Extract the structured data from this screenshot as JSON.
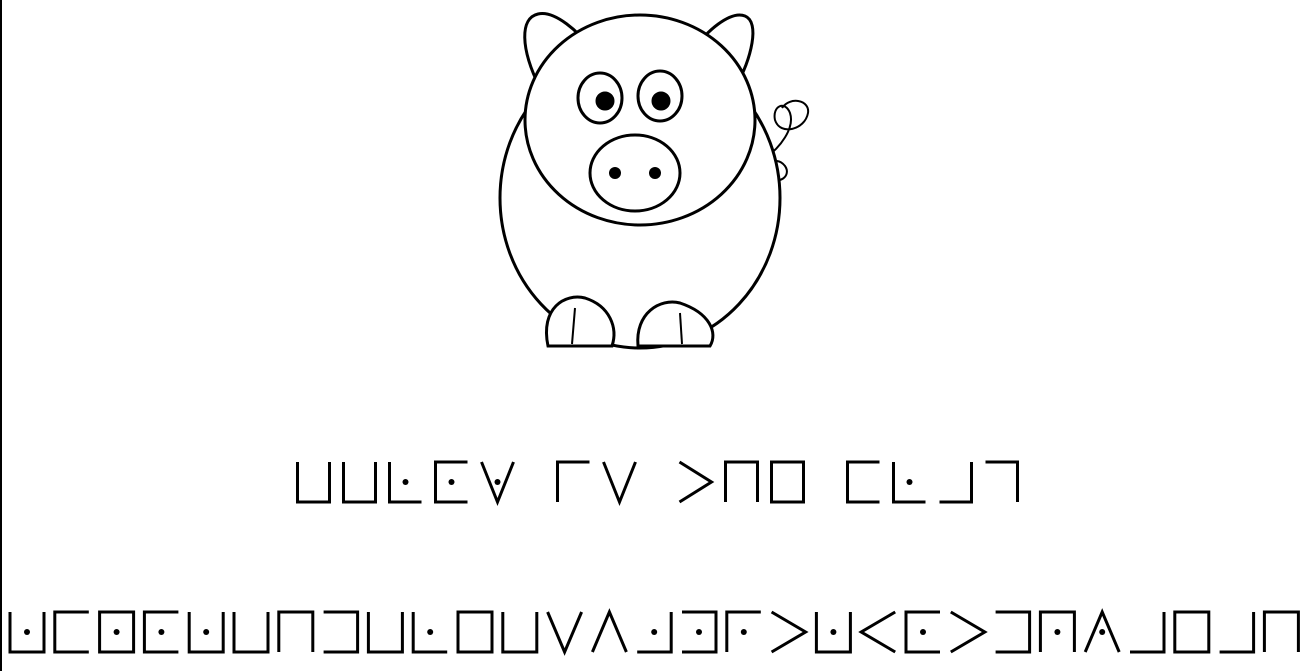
{
  "image": {
    "subject": "pig-illustration"
  },
  "cipher": {
    "line1_words": [
      [
        "U",
        "LT",
        "L.",
        "E.",
        "V."
      ],
      [
        "G",
        "V"
      ],
      [
        ">",
        "N",
        "O"
      ],
      [
        "C",
        "L.",
        "J",
        "7"
      ]
    ],
    "line2_glyphs": [
      "U.",
      "C",
      "O.",
      "E.",
      "U.",
      "U",
      "N",
      "]",
      "U",
      "L.",
      "O",
      "U",
      "V",
      "A",
      ".J",
      "].",
      "G.",
      ">",
      "U.",
      "<",
      "E.",
      ">",
      "]",
      "N.",
      "A.",
      "J",
      "O",
      "J",
      "N"
    ]
  },
  "colors": {
    "ink": "#000000",
    "paper": "#ffffff"
  }
}
